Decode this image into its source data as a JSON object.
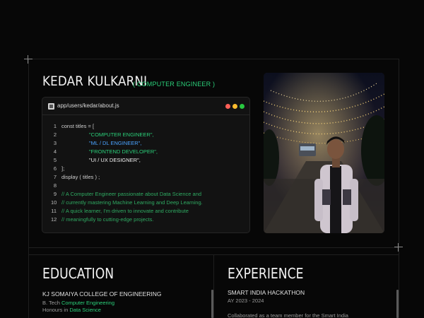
{
  "hero": {
    "name": "KEDAR KULKARNI",
    "role": "( COMPUTER ENGINEER )"
  },
  "code_window": {
    "file_path": "app/users/kedar/about.js",
    "lines": [
      {
        "num": "1",
        "text": "const  titles = ["
      },
      {
        "num": "2",
        "text": "\"COMPUTER ENGINEER\","
      },
      {
        "num": "3",
        "text": "\"ML / DL ENGINEER\","
      },
      {
        "num": "4",
        "text": "\"FRONTEND DEVELOPER\","
      },
      {
        "num": "5",
        "text": "\"UI / UX DESIGNER\","
      },
      {
        "num": "6",
        "text": "];"
      },
      {
        "num": "7",
        "text": "display ( titles ) ;"
      },
      {
        "num": "8",
        "text": ""
      },
      {
        "num": "9",
        "text": "// A Computer Engineer passionate about Data Science and"
      },
      {
        "num": "10",
        "text": "// currently mastering Machine Learning and Deep Learning."
      },
      {
        "num": "11",
        "text": "// A quick learner, I'm driven to innovate and contribute"
      },
      {
        "num": "12",
        "text": "// meaningfully to cutting-edge projects."
      }
    ]
  },
  "education": {
    "title": "EDUCATION",
    "college": "KJ SOMAIYA COLLEGE OF ENGINEERING",
    "degree_prefix": "B. Tech",
    "degree_field": "Computer Engineering",
    "honours_prefix": "Honours in",
    "honours_field": "Data Science"
  },
  "experience": {
    "title": "EXPERIENCE",
    "event": "SMART INDIA HACKATHON",
    "year": "AY 2023 - 2024",
    "desc": "Collaborated as a team member for the Smart India"
  },
  "colors": {
    "accent": "#2bd07a",
    "blue": "#4aa3ff",
    "background": "#070707"
  }
}
